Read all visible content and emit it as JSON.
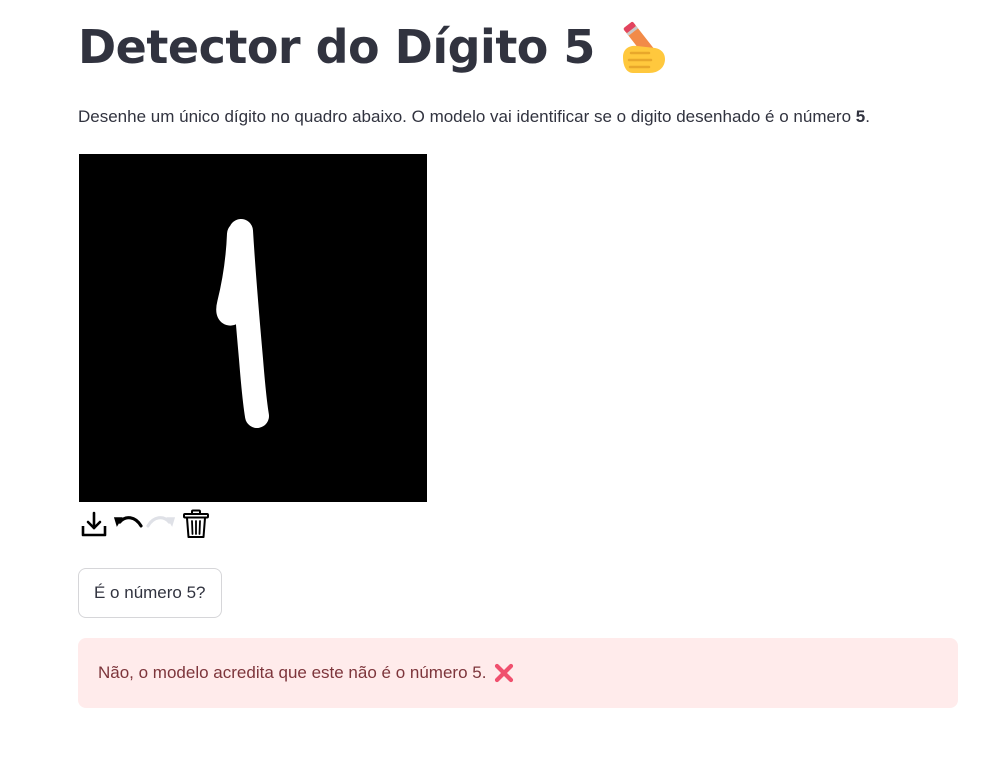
{
  "header": {
    "title": "Detector do Dígito 5",
    "title_emoji": "writing-hand-icon"
  },
  "intro": {
    "text_before": "Desenhe um único dígito no quadro abaixo. O modelo vai identificar se o digito desenhado é o número ",
    "text_bold": "5",
    "text_after": "."
  },
  "canvas": {
    "background_color": "#000000",
    "stroke_color": "#ffffff"
  },
  "toolbar": {
    "items": [
      {
        "icon": "download-icon",
        "enabled": true
      },
      {
        "icon": "undo-icon",
        "enabled": true
      },
      {
        "icon": "redo-icon",
        "enabled": false
      },
      {
        "icon": "trash-icon",
        "enabled": true
      }
    ]
  },
  "actions": {
    "check_button_label": "É o número 5?"
  },
  "result": {
    "message": "Não, o modelo acredita que este não é o número 5.",
    "icon": "cross-mark-icon",
    "background_color": "#ffebeb",
    "text_color": "#7d353b"
  }
}
